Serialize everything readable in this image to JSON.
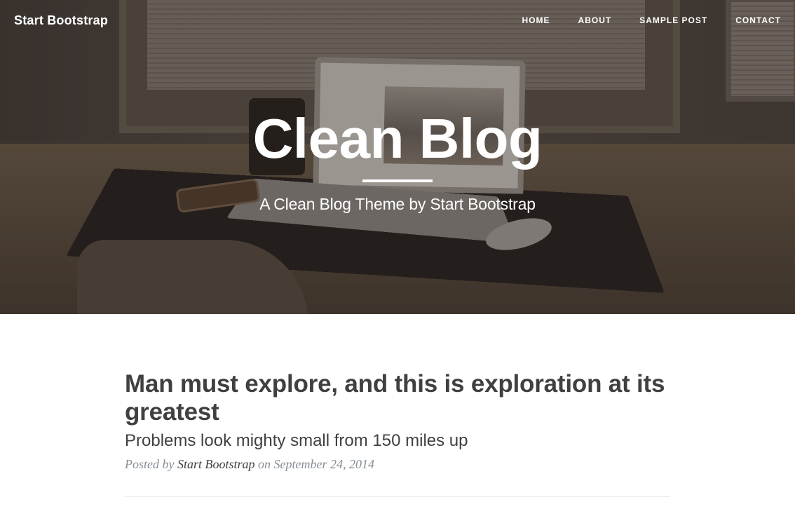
{
  "nav": {
    "brand": "Start Bootstrap",
    "items": [
      {
        "label": "HOME"
      },
      {
        "label": "ABOUT"
      },
      {
        "label": "SAMPLE POST"
      },
      {
        "label": "CONTACT"
      }
    ]
  },
  "hero": {
    "title": "Clean Blog",
    "subheading": "A Clean Blog Theme by Start Bootstrap"
  },
  "posts": [
    {
      "title": "Man must explore, and this is exploration at its greatest",
      "subtitle": "Problems look mighty small from 150 miles up",
      "meta_prefix": "Posted by",
      "author": "Start Bootstrap",
      "meta_on": "on",
      "date": "September 24, 2014"
    }
  ],
  "colors": {
    "text": "#404040",
    "meta": "#868e96",
    "hero_text": "#ffffff"
  }
}
